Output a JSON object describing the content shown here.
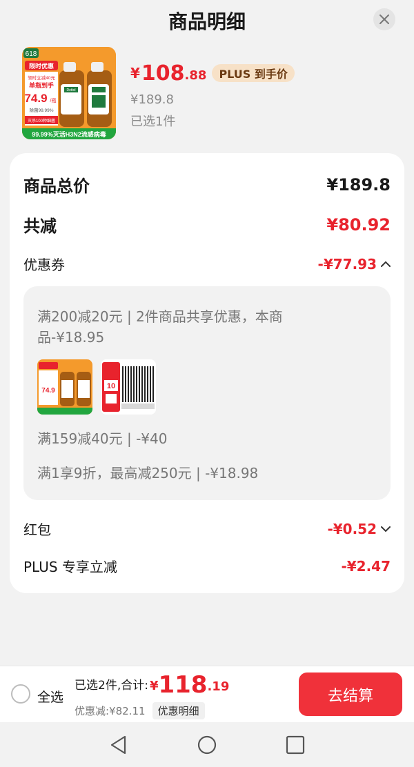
{
  "header": {
    "title": "商品明细"
  },
  "product": {
    "badge_618": "618",
    "promo_tag": "限时优惠",
    "promo_line1": "领时立减40元",
    "promo_line2": "单瓶到手",
    "promo_price": "74.9",
    "promo_unit": "/瓶",
    "promo_small": "除菌99.99%",
    "promo_small2": "灭杀100种细菌",
    "promo_footer": "99.99%灭活H3N2流感病毒",
    "brand": "Dettol",
    "price_yen": "¥",
    "price_int": "108",
    "price_dec": ".88",
    "plus_tag": "PLUS 到手价",
    "orig_price": "¥189.8",
    "selected": "已选1件"
  },
  "summary": {
    "total_label": "商品总价",
    "total_value": "¥189.8",
    "reduce_label": "共减",
    "reduce_value": "¥80.92",
    "coupon_label": "优惠券",
    "coupon_value": "-¥77.93",
    "coupon_box": {
      "line1": "满200减20元 | 2件商品共享优惠，本商",
      "line2": "品-¥18.95",
      "item2_tag": "10",
      "line3": "满159减40元 | -¥40",
      "line4": "满1享9折，最高减250元 | -¥18.98"
    },
    "redpack_label": "红包",
    "redpack_value": "-¥0.52",
    "plus_label": "PLUS 专享立减",
    "plus_value": "-¥2.47"
  },
  "bottom": {
    "select_all": "全选",
    "total_label": "已选2件,合计:",
    "total_yen": "¥",
    "total_int": "118",
    "total_dec": ".19",
    "discount": "优惠减:¥82.11",
    "detail_chip": "优惠明细",
    "checkout": "去结算"
  },
  "colors": {
    "accent_red": "#e8232d",
    "checkout_red": "#f0313a",
    "plus_tag_bg": "#f7e1c7"
  }
}
